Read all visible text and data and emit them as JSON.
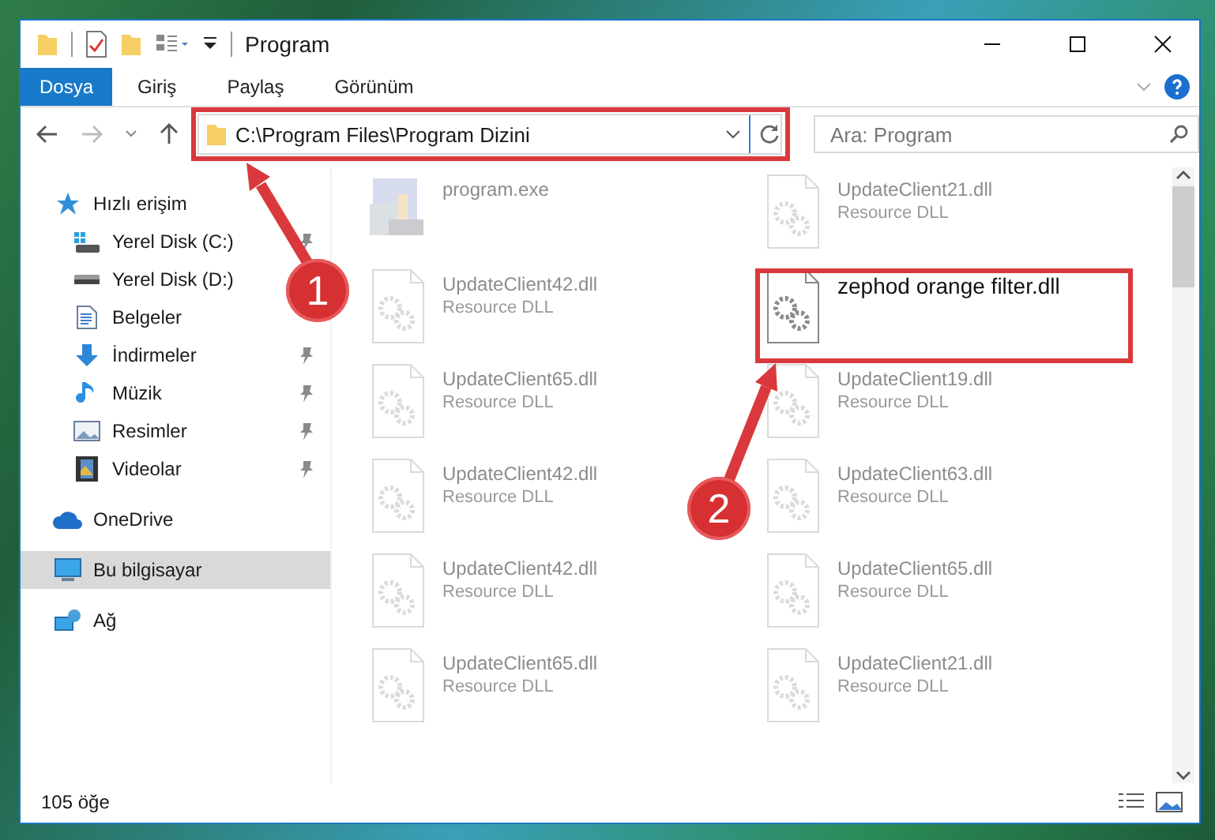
{
  "window": {
    "title": "Program"
  },
  "ribbon_tabs": [
    {
      "label": "Dosya",
      "selected": true
    },
    {
      "label": "Giriş",
      "selected": false
    },
    {
      "label": "Paylaş",
      "selected": false
    },
    {
      "label": "Görünüm",
      "selected": false
    }
  ],
  "address_bar": {
    "value": "C:\\Program Files\\Program Dizini"
  },
  "search": {
    "placeholder": "Ara: Program"
  },
  "sidebar": {
    "items": [
      {
        "label": "Hızlı erişim",
        "kind": "star",
        "selected": false,
        "children": [
          {
            "label": "Yerel Disk (C:)",
            "kind": "drive-win",
            "pinned": true,
            "selected": false
          },
          {
            "label": "Yerel Disk (D:)",
            "kind": "drive",
            "pinned": false,
            "selected": false
          },
          {
            "label": "Belgeler",
            "kind": "docs",
            "pinned": false,
            "selected": false
          },
          {
            "label": "İndirmeler",
            "kind": "download",
            "pinned": true,
            "selected": false
          },
          {
            "label": "Müzik",
            "kind": "music",
            "pinned": true,
            "selected": false
          },
          {
            "label": "Resimler",
            "kind": "pictures",
            "pinned": true,
            "selected": false
          },
          {
            "label": "Videolar",
            "kind": "video",
            "pinned": true,
            "selected": false
          }
        ]
      },
      {
        "label": "OneDrive",
        "kind": "cloud",
        "selected": false
      },
      {
        "label": "Bu bilgisayar",
        "kind": "computer",
        "selected": true
      },
      {
        "label": "Ağ",
        "kind": "network",
        "selected": false
      }
    ]
  },
  "files": [
    {
      "name": "program.exe",
      "kind": "exe",
      "faded": true
    },
    {
      "name": "UpdateClient21.dll",
      "type": "Resource DLL",
      "kind": "dll",
      "faded": true
    },
    {
      "name": "UpdateClient42.dll",
      "type": "Resource DLL",
      "kind": "dll",
      "faded": true
    },
    {
      "name": "zephod orange filter.dll",
      "kind": "dll",
      "faded": false
    },
    {
      "name": "UpdateClient65.dll",
      "type": "Resource DLL",
      "kind": "dll",
      "faded": true
    },
    {
      "name": "UpdateClient19.dll",
      "type": "Resource DLL",
      "kind": "dll",
      "faded": true
    },
    {
      "name": "UpdateClient42.dll",
      "type": "Resource DLL",
      "kind": "dll",
      "faded": true
    },
    {
      "name": "UpdateClient63.dll",
      "type": "Resource DLL",
      "kind": "dll",
      "faded": true
    },
    {
      "name": "UpdateClient42.dll",
      "type": "Resource DLL",
      "kind": "dll",
      "faded": true
    },
    {
      "name": "UpdateClient65.dll",
      "type": "Resource DLL",
      "kind": "dll",
      "faded": true
    },
    {
      "name": "UpdateClient65.dll",
      "type": "Resource DLL",
      "kind": "dll",
      "faded": true
    },
    {
      "name": "UpdateClient21.dll",
      "type": "Resource DLL",
      "kind": "dll",
      "faded": true
    }
  ],
  "annotations": [
    {
      "number": "1"
    },
    {
      "number": "2"
    }
  ],
  "status_bar": {
    "count": "105 öğe"
  }
}
